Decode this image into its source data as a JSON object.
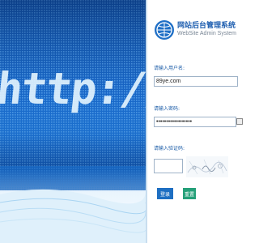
{
  "app": {
    "title_cn": "网站后台管理系统",
    "title_en": "WebSite Admin System",
    "hero_text": "http://www"
  },
  "login": {
    "username_label": "请输入用户名:",
    "username_value": "89ye.com",
    "password_label": "请输入密码:",
    "password_value": "••••••••••••••••••",
    "captcha_label": "请输入验证码:",
    "captcha_value": "",
    "login_button": "登录",
    "reset_button": "重置"
  },
  "colors": {
    "accent": "#1e6fc2",
    "reset": "#25a079",
    "label": "#1b5ca8"
  }
}
